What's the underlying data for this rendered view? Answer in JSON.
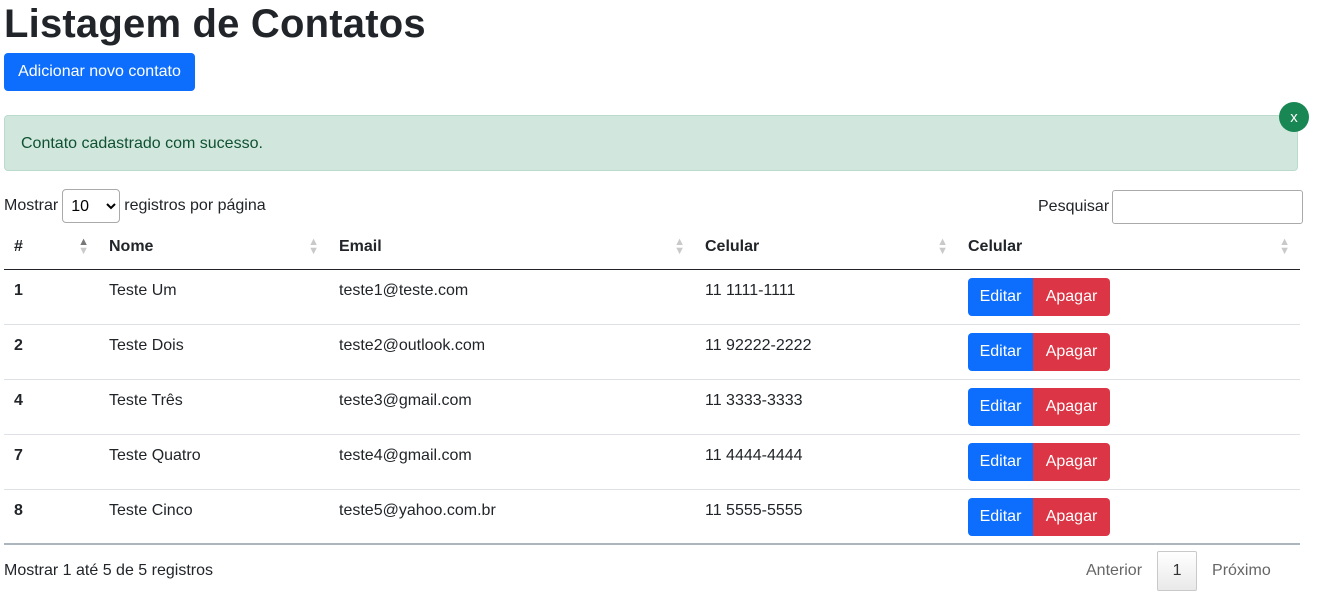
{
  "page": {
    "title": "Listagem de Contatos",
    "add_button": "Adicionar novo contato"
  },
  "alert": {
    "message": "Contato cadastrado com sucesso.",
    "close_label": "x"
  },
  "length_menu": {
    "prefix": "Mostrar",
    "selected": "10",
    "suffix": "registros por página"
  },
  "search": {
    "label": "Pesquisar",
    "value": ""
  },
  "table": {
    "headers": [
      "#",
      "Nome",
      "Email",
      "Celular",
      "Celular"
    ],
    "edit_label": "Editar",
    "delete_label": "Apagar",
    "rows": [
      {
        "id": "1",
        "name": "Teste Um",
        "email": "teste1@teste.com",
        "phone": "11 1111-1111"
      },
      {
        "id": "2",
        "name": "Teste Dois",
        "email": "teste2@outlook.com",
        "phone": "11 92222-2222"
      },
      {
        "id": "4",
        "name": "Teste Três",
        "email": "teste3@gmail.com",
        "phone": "11 3333-3333"
      },
      {
        "id": "7",
        "name": "Teste Quatro",
        "email": "teste4@gmail.com",
        "phone": "11 4444-4444"
      },
      {
        "id": "8",
        "name": "Teste Cinco",
        "email": "teste5@yahoo.com.br",
        "phone": "11 5555-5555"
      }
    ]
  },
  "footer": {
    "info": "Mostrar 1 até 5 de 5 registros",
    "previous": "Anterior",
    "page": "1",
    "next": "Próximo"
  },
  "colors": {
    "primary": "#0d6efd",
    "danger": "#dc3545",
    "success_bg": "#d1e7dd",
    "success_btn": "#198754"
  }
}
